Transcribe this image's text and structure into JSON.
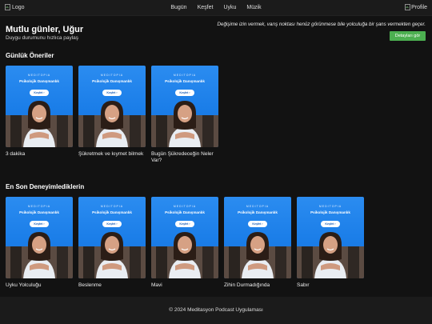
{
  "header": {
    "logo_alt": "Logo",
    "nav": [
      "Bugün",
      "Keşfet",
      "Uyku",
      "Müzik"
    ],
    "profile_alt": "Profile"
  },
  "greeting": {
    "title": "Mutlu günler, Uğur",
    "subtitle": "Duygu durumunu hızlıca paylaş"
  },
  "quote": {
    "text": "Değişime izin vermek, varış noktası henüz görünmese bile yolculuğa bir şans vermekten geçer.",
    "button": "Detayları gör"
  },
  "thumbnail": {
    "brand": "MEDITOPIA",
    "title": "Psikolojik Danışmanlık",
    "cta": "Keşfet"
  },
  "daily": {
    "title": "Günlük Öneriler",
    "items": [
      "3 dakika",
      "Şükretmek ve kıymet bilmek",
      "Bugün Şükredeceğin Neler Var?"
    ]
  },
  "recent": {
    "title": "En Son Deneyimlediklerin",
    "items": [
      "Uyku Yolculuğu",
      "Beslenme",
      "Mavi",
      "Zihin Durmadığında",
      "Sabır"
    ]
  },
  "footer": {
    "text": "© 2024 Meditasyon Podcast Uygulaması"
  },
  "colors": {
    "background": "#121212",
    "topbar": "#1b1b1b",
    "accent_green": "#4caf50",
    "thumbnail_blue": "#1a7de8"
  }
}
